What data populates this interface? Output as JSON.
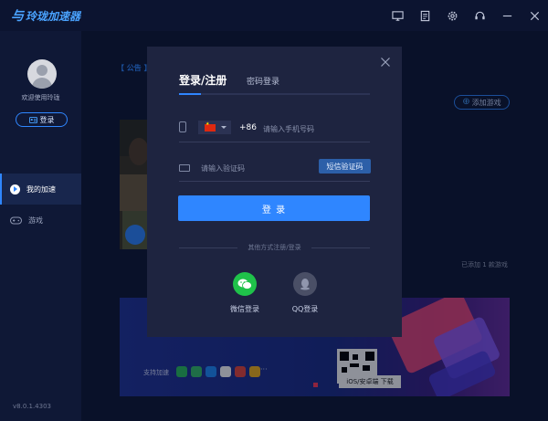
{
  "app": {
    "logo_mark": "与",
    "logo_text": "玲珑加速器"
  },
  "titlebar": {
    "icons": [
      "screen-icon",
      "clipboard-icon",
      "gear-icon",
      "headset-icon",
      "minimize-icon",
      "close-icon"
    ]
  },
  "sidebar": {
    "welcome": "欢迎使用玲珑",
    "login_label": "登录",
    "items": [
      {
        "label": "我的加速",
        "icon": "rocket-icon",
        "active": true
      },
      {
        "label": "游戏",
        "icon": "gamepad-icon",
        "active": false
      }
    ],
    "version": "v8.0.1.4303"
  },
  "main": {
    "notice_label": "【 公告 】",
    "add_game_label": "添加游戏",
    "added_count": "已添加 1 款游戏",
    "banner": {
      "support_label": "支持加速",
      "dots": "···",
      "qr_label": "iOS/安卓端 下载"
    }
  },
  "modal": {
    "tab_login": "登录/注册",
    "tab_password": "密码登录",
    "country_code": "+86",
    "phone_placeholder": "请输入手机号码",
    "code_placeholder": "请输入验证码",
    "sms_button": "短信验证码",
    "login_button": "登 录",
    "other_methods": "其他方式注册/登录",
    "wechat_label": "微信登录",
    "qq_label": "QQ登录"
  },
  "colors": {
    "accent": "#2f86ff",
    "background": "#0d1633",
    "modal": "#1e2440",
    "wechat": "#1fc24a"
  }
}
